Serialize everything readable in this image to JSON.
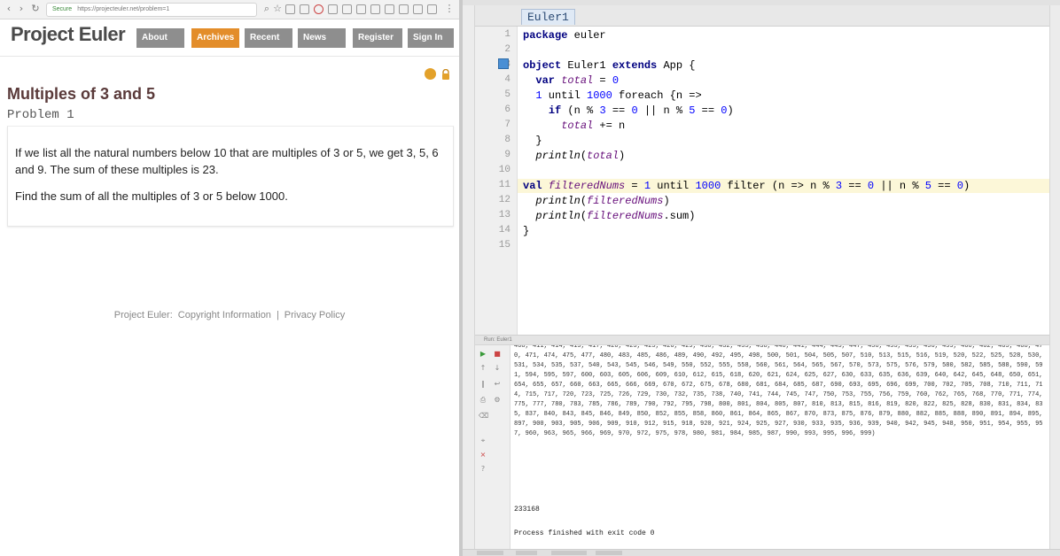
{
  "browser": {
    "url_secure_label": "Secure",
    "url": "https://projecteuler.net/problem=1"
  },
  "site": {
    "title": "Project Euler",
    "nav": [
      "About",
      "Archives",
      "Recent",
      "News",
      "Register",
      "Sign In"
    ],
    "active_nav": "Archives"
  },
  "problem": {
    "title": "Multiples of 3 and 5",
    "subtitle": "Problem 1",
    "paragraphs": [
      "If we list all the natural numbers below 10 that are multiples of 3 or 5, we get 3, 5, 6 and 9. The sum of these multiples is 23.",
      "Find the sum of all the multiples of 3 or 5 below 1000."
    ]
  },
  "footer": {
    "site": "Project Euler:",
    "copyright": "Copyright Information",
    "separator": "|",
    "privacy": "Privacy Policy"
  },
  "ide": {
    "editor_tab": "Euler1",
    "line_numbers": [
      "1",
      "2",
      "3",
      "4",
      "5",
      "6",
      "7",
      "8",
      "9",
      "10",
      "11",
      "12",
      "13",
      "14",
      "15"
    ],
    "code": {
      "l1": {
        "kw": "package",
        "rest": " euler"
      },
      "l3": {
        "kw1": "object",
        "name": " Euler1 ",
        "kw2": "extends",
        "rest": " App {"
      },
      "l4": {
        "kw": "var",
        "var": "total",
        "eq": " = ",
        "num": "0"
      },
      "l5": {
        "num1": "1",
        "mid": " until ",
        "num2": "1000",
        "rest": " foreach {n =>"
      },
      "l6": {
        "kw": "if",
        "a": " (n % ",
        "n3": "3",
        "b": " == ",
        "n0a": "0",
        "c": " || n % ",
        "n5": "5",
        "d": " == ",
        "n0b": "0",
        "e": ")"
      },
      "l7": {
        "var": "total",
        "rest": " += n"
      },
      "l8": {
        "rest": "}"
      },
      "l9": {
        "fn": "println",
        "open": "(",
        "var": "total",
        "close": ")"
      },
      "l11": {
        "kw": "val",
        "var": "filteredNums",
        "a": " = ",
        "n1": "1",
        "b": " until ",
        "n1000": "1000",
        "c": " filter (n => n % ",
        "n3": "3",
        "d": " == ",
        "n0a": "0",
        "e": " || n % ",
        "n5": "5",
        "f": " == ",
        "n0b": "0",
        "g": ")"
      },
      "l12": {
        "fn": "println",
        "open": "(",
        "var": "filteredNums",
        "close": ")"
      },
      "l13": {
        "fn": "println",
        "open": "(",
        "var": "filteredNums",
        "rest": ".sum)"
      },
      "l14": {
        "rest": "}"
      }
    },
    "run_tab": "Run: Euler1",
    "console_numbers": "408, 411, 414, 415, 417, 420, 423, 425, 426, 429, 430, 432, 435, 438, 440, 441, 444, 445, 447, 450, 453, 455, 456, 459, 460, 462, 465, 468, 470, 471, 474, 475, 477, 480, 483, 485, 486, 489, 490, 492, 495, 498, 500, 501, 504, 505, 507, 510, 513, 515, 516, 519, 520, 522, 525, 528, 530, 531, 534, 535, 537, 540, 543, 545, 546, 549, 550, 552, 555, 558, 560, 561, 564, 565, 567, 570, 573, 575, 576, 579, 580, 582, 585, 588, 590, 591, 594, 595, 597, 600, 603, 605, 606, 609, 610, 612, 615, 618, 620, 621, 624, 625, 627, 630, 633, 635, 636, 639, 640, 642, 645, 648, 650, 651, 654, 655, 657, 660, 663, 665, 666, 669, 670, 672, 675, 678, 680, 681, 684, 685, 687, 690, 693, 695, 696, 699, 700, 702, 705, 708, 710, 711, 714, 715, 717, 720, 723, 725, 726, 729, 730, 732, 735, 738, 740, 741, 744, 745, 747, 750, 753, 755, 756, 759, 760, 762, 765, 768, 770, 771, 774, 775, 777, 780, 783, 785, 786, 789, 790, 792, 795, 798, 800, 801, 804, 805, 807, 810, 813, 815, 816, 819, 820, 822, 825, 828, 830, 831, 834, 835, 837, 840, 843, 845, 846, 849, 850, 852, 855, 858, 860, 861, 864, 865, 867, 870, 873, 875, 876, 879, 880, 882, 885, 888, 890, 891, 894, 895, 897, 900, 903, 905, 906, 909, 910, 912, 915, 918, 920, 921, 924, 925, 927, 930, 933, 935, 936, 939, 940, 942, 945, 948, 950, 951, 954, 955, 957, 960, 963, 965, 966, 969, 970, 972, 975, 978, 980, 981, 984, 985, 987, 990, 993, 995, 996, 999)",
    "console_result": "233168",
    "console_exit": "Process finished with exit code 0"
  },
  "colors": {
    "nav_inactive": "#8e8e8e",
    "nav_active": "#e38d2a",
    "keyword": "#000080",
    "number": "#0000ff",
    "field": "#660e7a",
    "current_line": "#fcf7d8"
  }
}
